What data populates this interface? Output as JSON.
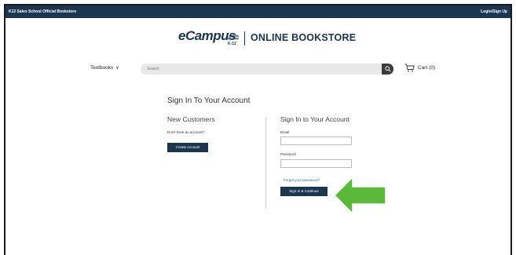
{
  "topbar": {
    "school": "K12 Sales School Official Bookstore",
    "login": "Login/Sign Up"
  },
  "logo": {
    "ecampus": "eCampus",
    "com": ".com",
    "k12": "K-12",
    "bookstore": "ONLINE BOOKSTORE"
  },
  "nav": {
    "textbooks": "Textbooks",
    "chevron": "∨",
    "search_placeholder": "Search",
    "cart": "Cart (0)"
  },
  "page": {
    "title": "Sign In To Your Account"
  },
  "new_customers": {
    "heading": "New Customers",
    "prompt": "Don't have an account?",
    "create_button": "Create Account"
  },
  "sign_in": {
    "heading": "Sign In to Your Account",
    "email_label": "Email",
    "email_value": "",
    "password_label": "Password",
    "password_value": "",
    "forgot": "Forgot your password?",
    "continue_button": "Sign In & Continue"
  },
  "colors": {
    "navy": "#1c3550",
    "arrow_green": "#5cb83a",
    "link_blue": "#2c6fb0"
  },
  "icons": {
    "search": "magnifier-icon",
    "cart": "shopping-cart-icon",
    "arrow": "green-arrow-icon"
  }
}
